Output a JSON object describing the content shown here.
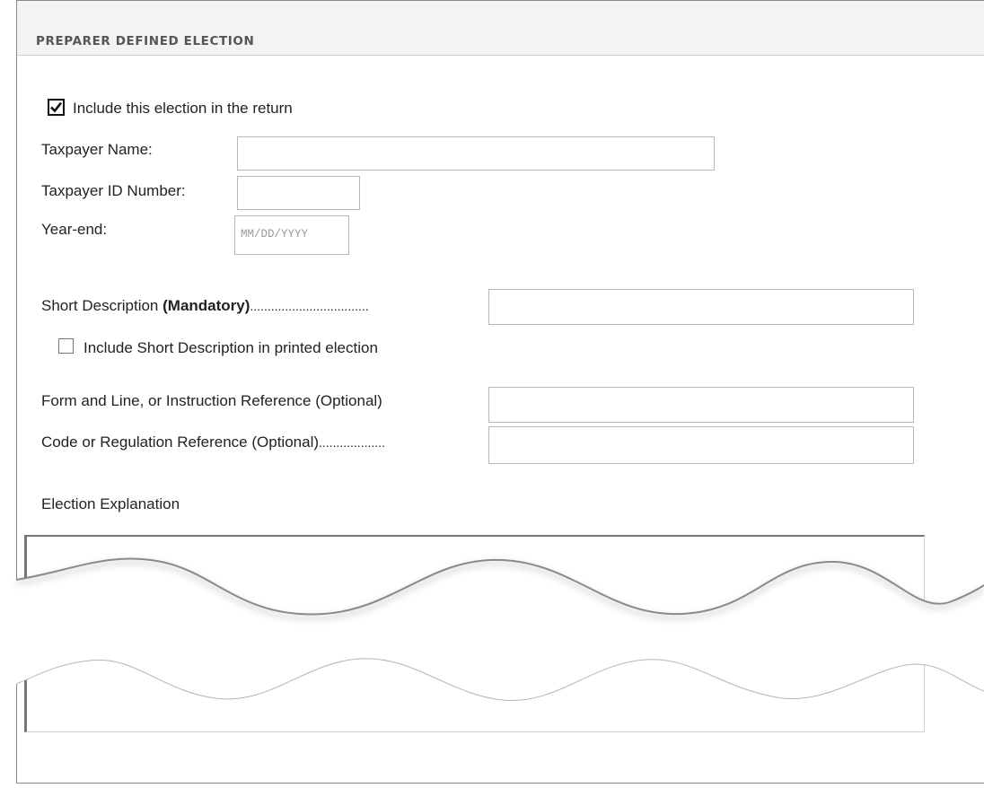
{
  "header": {
    "title": "PREPARER DEFINED ELECTION"
  },
  "include_election": {
    "checked": true,
    "label": "Include this election in the return"
  },
  "taxpayer_name": {
    "label": "Taxpayer Name:",
    "value": ""
  },
  "taxpayer_id": {
    "label": "Taxpayer ID Number:",
    "value": ""
  },
  "year_end": {
    "label": "Year-end:",
    "placeholder": "MM/DD/YYYY",
    "value": ""
  },
  "short_description": {
    "label": "Short Description ",
    "mandatory": "(Mandatory)",
    "leader": "..................................",
    "value": ""
  },
  "include_short_description": {
    "checked": false,
    "label": "Include Short Description in printed election"
  },
  "form_line_reference": {
    "label": "Form and Line, or Instruction Reference (Optional)",
    "value": ""
  },
  "code_regulation_reference": {
    "label": "Code or Regulation Reference (Optional)",
    "leader": "...................",
    "value": ""
  },
  "election_explanation": {
    "label": "Election Explanation",
    "value": ""
  }
}
